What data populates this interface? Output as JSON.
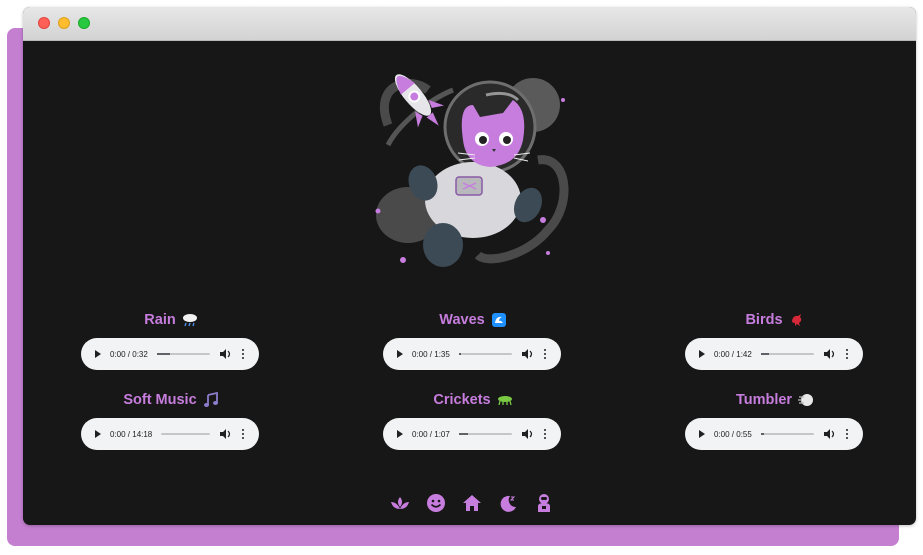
{
  "colors": {
    "accent": "#c77dde",
    "background": "#171717",
    "frame": "#c47fd1",
    "player": "#f1f3f4"
  },
  "hero": {
    "icon": "astronaut-cat-illustration"
  },
  "sounds": [
    {
      "title": "Rain",
      "icon": "rain-cloud-icon",
      "time": "0:00 / 0:32",
      "progress": 0.25
    },
    {
      "title": "Waves",
      "icon": "wave-icon",
      "time": "0:00 / 1:35",
      "progress": 0.05
    },
    {
      "title": "Birds",
      "icon": "bird-icon",
      "time": "0:00 / 1:42",
      "progress": 0.15
    },
    {
      "title": "Soft Music",
      "icon": "music-note-icon",
      "time": "0:00 / 14:18",
      "progress": 0.0
    },
    {
      "title": "Crickets",
      "icon": "cricket-icon",
      "time": "0:00 / 1:07",
      "progress": 0.18
    },
    {
      "title": "Tumbler",
      "icon": "tumbler-icon",
      "time": "0:00 / 0:55",
      "progress": 0.06
    }
  ],
  "nav": [
    {
      "icon": "lotus-icon"
    },
    {
      "icon": "smile-icon"
    },
    {
      "icon": "home-icon"
    },
    {
      "icon": "moon-sleep-icon"
    },
    {
      "icon": "astronaut-icon"
    }
  ]
}
